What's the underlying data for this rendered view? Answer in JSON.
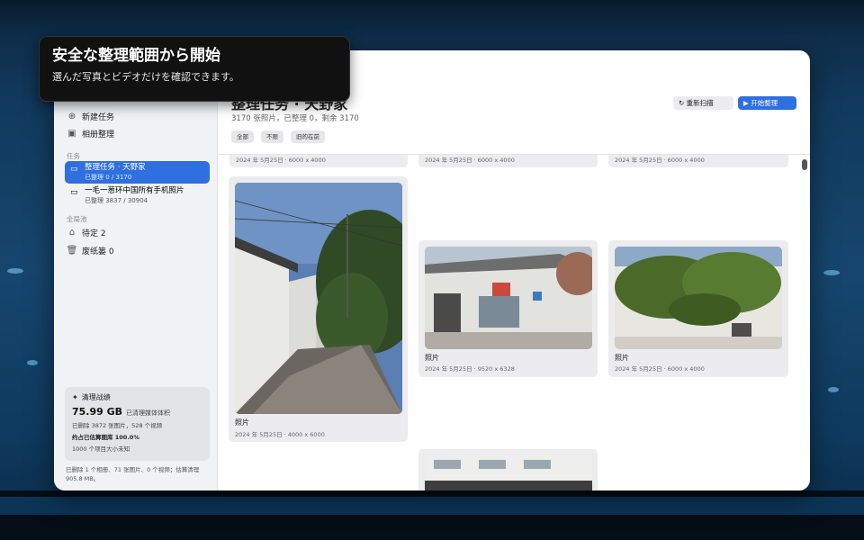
{
  "tooltip": {
    "title": "安全な整理範囲から開始",
    "subtitle": "選んだ写真とビデオだけを確認できます。"
  },
  "sidebar": {
    "nav": [
      {
        "label": "新建任务",
        "icon": "plus-circle-icon"
      },
      {
        "label": "相册整理",
        "icon": "album-icon"
      }
    ],
    "tasks_label": "任务",
    "tasks": [
      {
        "title": "整理任务 · 天野家",
        "sub": "已整理 0 / 3170",
        "icon": "folder-icon"
      },
      {
        "title": "一毛一葱环中国所有手机照片",
        "sub": "已整理 3837 / 30904",
        "icon": "folder-icon"
      }
    ],
    "pool_label": "全局池",
    "pool": [
      {
        "label": "待定 2",
        "icon": "tray-icon"
      },
      {
        "label": "废纸篓 0",
        "icon": "trash-icon"
      }
    ],
    "stats": {
      "heading": "清理战绩",
      "size": "75.99 GB",
      "size_note": "已清理媒体体积",
      "deleted": "已删除 3872 张图片，528 个视频",
      "estimate": "约占已估算图库 100.0%",
      "unknown": "1000 个项目大小未知"
    },
    "footnote": "已删除 1 个相册、71 张图片、0 个视频；估算清理 905.8 MB。"
  },
  "main": {
    "title": "整理任务 · 天野家",
    "subtitle": "3170 张照片，已整理 0，剩余 3170",
    "filters": [
      "全部",
      "不限",
      "旧的在前"
    ],
    "rescan_label": "重新扫描",
    "start_label": "开始整理",
    "accent": "#2f6fde",
    "top_cards": [
      {
        "meta": "2024 年 5月25日 · 6000 x 4000"
      },
      {
        "meta": "2024 年 5月25日 · 6000 x 4000"
      },
      {
        "meta": "2024 年 5月25日 · 6000 x 4000"
      }
    ],
    "photos": [
      {
        "name": "照片",
        "meta": "2024 年 5月25日 · 4000 x 6000"
      },
      {
        "name": "照片",
        "meta": "2024 年 5月25日 · 9520 x 6328"
      },
      {
        "name": "照片",
        "meta": "2024 年 5月25日 · 6000 x 4000"
      }
    ]
  }
}
